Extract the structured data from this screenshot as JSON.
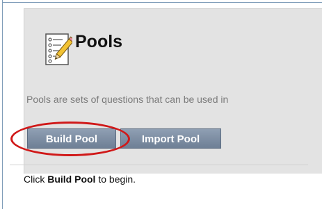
{
  "page": {
    "title": "Pools",
    "description": "Pools are sets of questions that can be used in",
    "icon": "test-pencil-icon"
  },
  "actions": {
    "build_label": "Build Pool",
    "import_label": "Import Pool"
  },
  "hint": {
    "prefix": "Click ",
    "emphasis": "Build Pool",
    "suffix": " to begin."
  },
  "colors": {
    "panel_bg": "#e3e3e3",
    "button_bg": "#7b8ca2",
    "highlight": "#d01818"
  }
}
